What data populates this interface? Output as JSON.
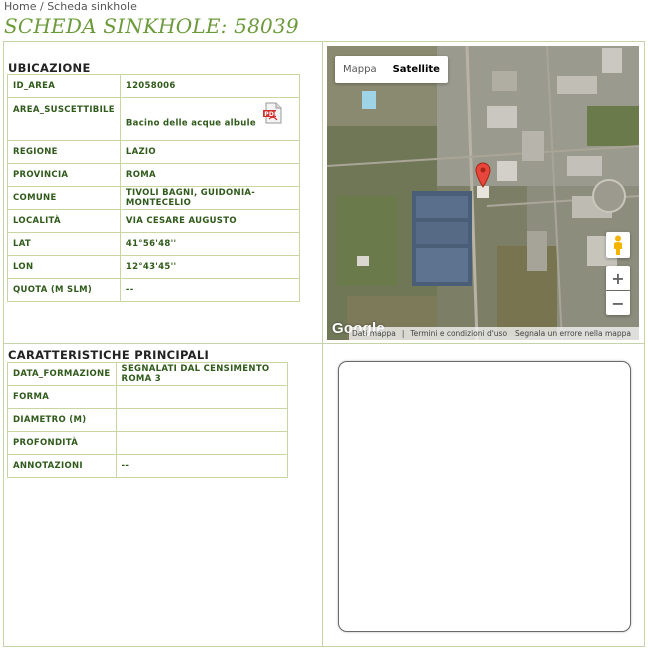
{
  "breadcrumb": {
    "home": "Home",
    "separator": " / ",
    "current": "Scheda sinkhole"
  },
  "page": {
    "title": "SCHEDA SINKHOLE: 58039"
  },
  "ubicazione": {
    "title": "UBICAZIONE",
    "rows": [
      {
        "key": "ID_AREA",
        "value": "12058006"
      },
      {
        "key": "AREA_SUSCETTIBILE",
        "value": "Bacino delle acque albule"
      },
      {
        "key": "REGIONE",
        "value": "LAZIO"
      },
      {
        "key": "PROVINCIA",
        "value": "ROMA"
      },
      {
        "key": "COMUNE",
        "value": "TIVOLI BAGNI, GUIDONIA-MONTECELIO"
      },
      {
        "key": "LOCALITÀ",
        "value": "VIA CESARE AUGUSTO"
      },
      {
        "key": "LAT",
        "value": "41°56'48''"
      },
      {
        "key": "LON",
        "value": "12°43'45''"
      },
      {
        "key": "QUOTA (M SLM)",
        "value": "--"
      }
    ],
    "pdf_icon": "pdf-file-icon"
  },
  "caratteristiche": {
    "title": "CARATTERISTICHE PRINCIPALI",
    "rows": [
      {
        "key": "DATA_FORMAZIONE",
        "value": "SEGNALATI DAL CENSIMENTO ROMA 3"
      },
      {
        "key": "FORMA",
        "value": ""
      },
      {
        "key": "DIAMETRO (M)",
        "value": ""
      },
      {
        "key": "PROFONDITÀ",
        "value": ""
      },
      {
        "key": "ANNOTAZIONI",
        "value": "--"
      }
    ]
  },
  "map": {
    "tab_map": "Mappa",
    "tab_satellite": "Satellite",
    "active_tab": "Satellite",
    "zoom_in": "+",
    "zoom_out": "−",
    "logo": "Google",
    "footer_data": "Dati mappa",
    "footer_terms": "Termini e condizioni d'uso",
    "footer_report": "Segnala un errore nella mappa"
  },
  "colors": {
    "accent": "#6b9a3a",
    "border": "#c5d3a8",
    "table_text": "#2f5a1a"
  }
}
